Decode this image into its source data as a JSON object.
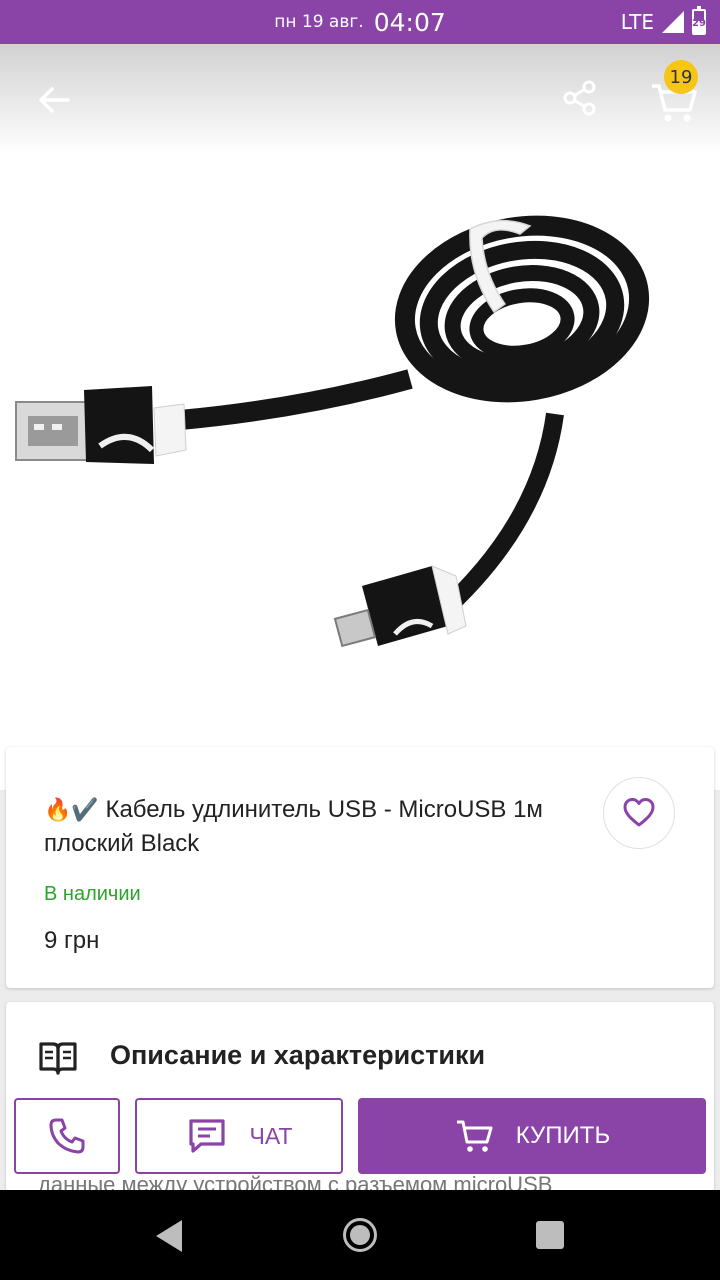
{
  "status_bar": {
    "date": "пн 19 авг.",
    "time": "04:07",
    "network": "LTE",
    "battery": "29"
  },
  "header": {
    "cart_count": "19",
    "icons": {
      "back": "arrow-left-icon",
      "share": "share-icon",
      "cart": "cart-icon"
    }
  },
  "product": {
    "title_emoji": "🔥✔️",
    "title": "Кабель удлинитель USB - MicroUSB 1м плоский Black",
    "availability": "В наличии",
    "price": "9 грн"
  },
  "description": {
    "heading": "Описание и характеристики",
    "visible_text_fragment": "данные между устройством с разъемом microUSB"
  },
  "actions": {
    "chat_label": "ЧАТ",
    "buy_label": "КУПИТЬ"
  },
  "colors": {
    "brand": "#8a44a8",
    "in_stock": "#2aa52a",
    "badge": "#f5c518"
  }
}
